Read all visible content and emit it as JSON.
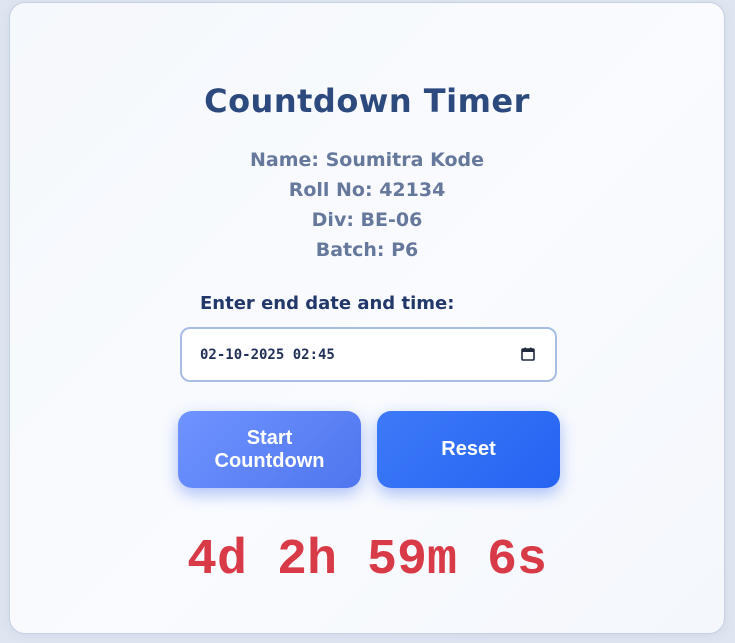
{
  "header": {
    "title": "Countdown Timer"
  },
  "student": {
    "name": "Name: Soumitra Kode",
    "roll": "Roll No: 42134",
    "div": "Div: BE-06",
    "batch": "Batch: P6"
  },
  "form": {
    "label": "Enter end date and time:",
    "datetime_value": "02-10-2025 02:45",
    "calendar_icon": "calendar-icon"
  },
  "buttons": {
    "start_label": "Start Countdown",
    "reset_label": "Reset"
  },
  "timer": {
    "display": "4d 2h 59m 6s"
  },
  "colors": {
    "title": "#2c4a7e",
    "countdown": "#d93a47",
    "start_button": "#5a82f5",
    "reset_button": "#2f6ef5"
  }
}
